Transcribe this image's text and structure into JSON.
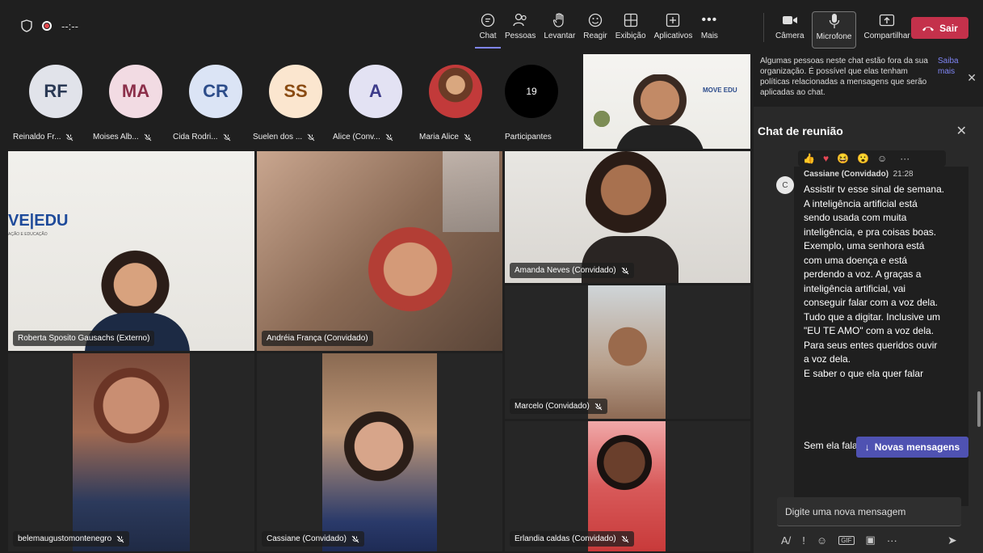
{
  "topbar": {
    "timer": "--:--",
    "buttons": [
      {
        "label": "Chat",
        "icon": "chat-icon"
      },
      {
        "label": "Pessoas",
        "icon": "people-icon"
      },
      {
        "label": "Levantar",
        "icon": "raise-hand-icon"
      },
      {
        "label": "Reagir",
        "icon": "react-icon"
      },
      {
        "label": "Exibição",
        "icon": "view-icon"
      },
      {
        "label": "Aplicativos",
        "icon": "apps-icon"
      },
      {
        "label": "Mais",
        "icon": "more-icon"
      }
    ],
    "right_buttons": [
      {
        "label": "Câmera",
        "icon": "camera-icon"
      },
      {
        "label": "Microfone",
        "icon": "mic-icon"
      },
      {
        "label": "Compartilhar",
        "icon": "share-icon"
      }
    ],
    "leave_label": "Sair"
  },
  "strip": {
    "participants": [
      {
        "initials": "RF",
        "name": "Reinaldo Fr...",
        "bg": "#e1e3ea",
        "fg": "#2b3a55"
      },
      {
        "initials": "MA",
        "name": "Moises Alb...",
        "bg": "#f2dbe3",
        "fg": "#8c2f4a"
      },
      {
        "initials": "CR",
        "name": "Cida Rodri...",
        "bg": "#dbe4f5",
        "fg": "#2d4d8a"
      },
      {
        "initials": "SS",
        "name": "Suelen dos ...",
        "bg": "#fbe6cf",
        "fg": "#8a4b12"
      },
      {
        "initials": "A",
        "name": "Alice (Conv...",
        "bg": "#e3e2f3",
        "fg": "#3d3b8a"
      },
      {
        "initials": "",
        "name": "Maria Alice",
        "bg": "#c23a3a",
        "fg": "#fff"
      }
    ],
    "count": "19",
    "count_label": "Participantes"
  },
  "grid": {
    "tiles": [
      {
        "name": "Roberta Sposito Gausachs (Externo)",
        "muted": false
      },
      {
        "name": "Andréia França (Convidado)",
        "muted": false
      },
      {
        "name": "Amanda Neves (Convidado)",
        "muted": true
      },
      {
        "name": "Marcelo (Convidado)",
        "muted": true
      },
      {
        "name": "belemaugustomontenegro",
        "muted": true
      },
      {
        "name": "Cassiane (Convidado)",
        "muted": true
      },
      {
        "name": "Erlandia caldas (Convidado)",
        "muted": true
      }
    ],
    "logo_text": "VE|EDU",
    "logo_sub": "AÇÃO E EDUCAÇÃO",
    "self_logo": "MOVE EDU"
  },
  "panel": {
    "notice": "Algumas pessoas neste chat estão fora da sua organização. É possível que elas tenham políticas relacionadas a mensagens que serão aplicadas ao chat.",
    "notice_link": "Saiba mais",
    "title": "Chat de reunião",
    "message": {
      "avatar": "C",
      "author": "Cassiane (Convidado)",
      "time": "21:28",
      "lines": [
        "Assistir tv esse sinal de semana.",
        "A inteligência artificial está sendo usada com muita inteligência, e pra coisas boas.",
        "Exemplo, uma senhora está com uma doença e está perdendo a voz. A graças a inteligência artificial, vai conseguir falar com a voz dela. Tudo que a digitar. Inclusive um \"EU TE AMO\" com a voz dela. Para seus entes queridos ouvir a voz dela.",
        "E saber o que ela quer falar"
      ],
      "bottom": "Sem ela fala"
    },
    "new_messages": "Novas mensagens",
    "compose_placeholder": "Digite uma nova mensagem"
  }
}
